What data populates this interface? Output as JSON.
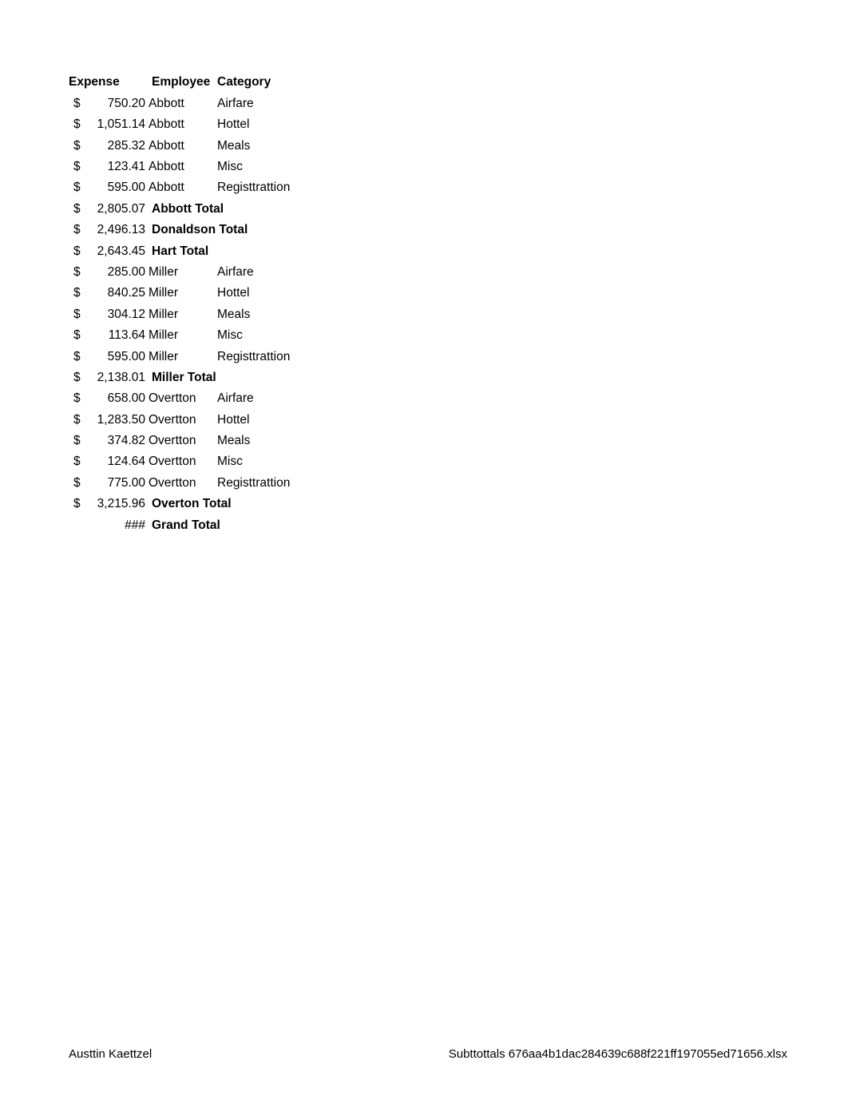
{
  "document": {
    "type": "spreadsheet-print-preview",
    "background_color": "#ffffff",
    "text_color": "#000000"
  },
  "table": {
    "headers": {
      "expense": "Expense",
      "employee": "Employee",
      "category": "Category"
    },
    "rows": [
      {
        "kind": "data",
        "currency": "$",
        "amount": "750.20",
        "employee": "Abbott",
        "category": "Airfare"
      },
      {
        "kind": "data",
        "currency": "$",
        "amount": "1,051.14",
        "employee": "Abbott",
        "category": "Hottel"
      },
      {
        "kind": "data",
        "currency": "$",
        "amount": "285.32",
        "employee": "Abbott",
        "category": "Meals"
      },
      {
        "kind": "data",
        "currency": "$",
        "amount": "123.41",
        "employee": "Abbott",
        "category": "Misc"
      },
      {
        "kind": "data",
        "currency": "$",
        "amount": "595.00",
        "employee": "Abbott",
        "category": "Registtrattion"
      },
      {
        "kind": "subtotal",
        "currency": "$",
        "amount": "2,805.07",
        "label": "Abbott Total"
      },
      {
        "kind": "subtotal",
        "currency": "$",
        "amount": "2,496.13",
        "label": "Donaldson Total"
      },
      {
        "kind": "subtotal",
        "currency": "$",
        "amount": "2,643.45",
        "label": "Hart Total"
      },
      {
        "kind": "data",
        "currency": "$",
        "amount": "285.00",
        "employee": "Miller",
        "category": "Airfare"
      },
      {
        "kind": "data",
        "currency": "$",
        "amount": "840.25",
        "employee": "Miller",
        "category": "Hottel"
      },
      {
        "kind": "data",
        "currency": "$",
        "amount": "304.12",
        "employee": "Miller",
        "category": "Meals"
      },
      {
        "kind": "data",
        "currency": "$",
        "amount": "113.64",
        "employee": "Miller",
        "category": "Misc"
      },
      {
        "kind": "data",
        "currency": "$",
        "amount": "595.00",
        "employee": "Miller",
        "category": "Registtrattion"
      },
      {
        "kind": "subtotal",
        "currency": "$",
        "amount": "2,138.01",
        "label": "Miller Total"
      },
      {
        "kind": "data",
        "currency": "$",
        "amount": "658.00",
        "employee": "Overtton",
        "category": "Airfare"
      },
      {
        "kind": "data",
        "currency": "$",
        "amount": "1,283.50",
        "employee": "Overtton",
        "category": "Hottel"
      },
      {
        "kind": "data",
        "currency": "$",
        "amount": "374.82",
        "employee": "Overtton",
        "category": "Meals"
      },
      {
        "kind": "data",
        "currency": "$",
        "amount": "124.64",
        "employee": "Overtton",
        "category": "Misc"
      },
      {
        "kind": "data",
        "currency": "$",
        "amount": "775.00",
        "employee": "Overtton",
        "category": "Registtrattion"
      },
      {
        "kind": "subtotal",
        "currency": "$",
        "amount": "3,215.96",
        "label": "Overton Total"
      },
      {
        "kind": "grandtotal",
        "currency": "",
        "amount": "###",
        "label": "Grand Total"
      }
    ]
  },
  "footer": {
    "left": "Austtin Kaettzel",
    "right": "Subttottals 676aa4b1dac284639c688f221ff197055ed71656.xlsx"
  }
}
